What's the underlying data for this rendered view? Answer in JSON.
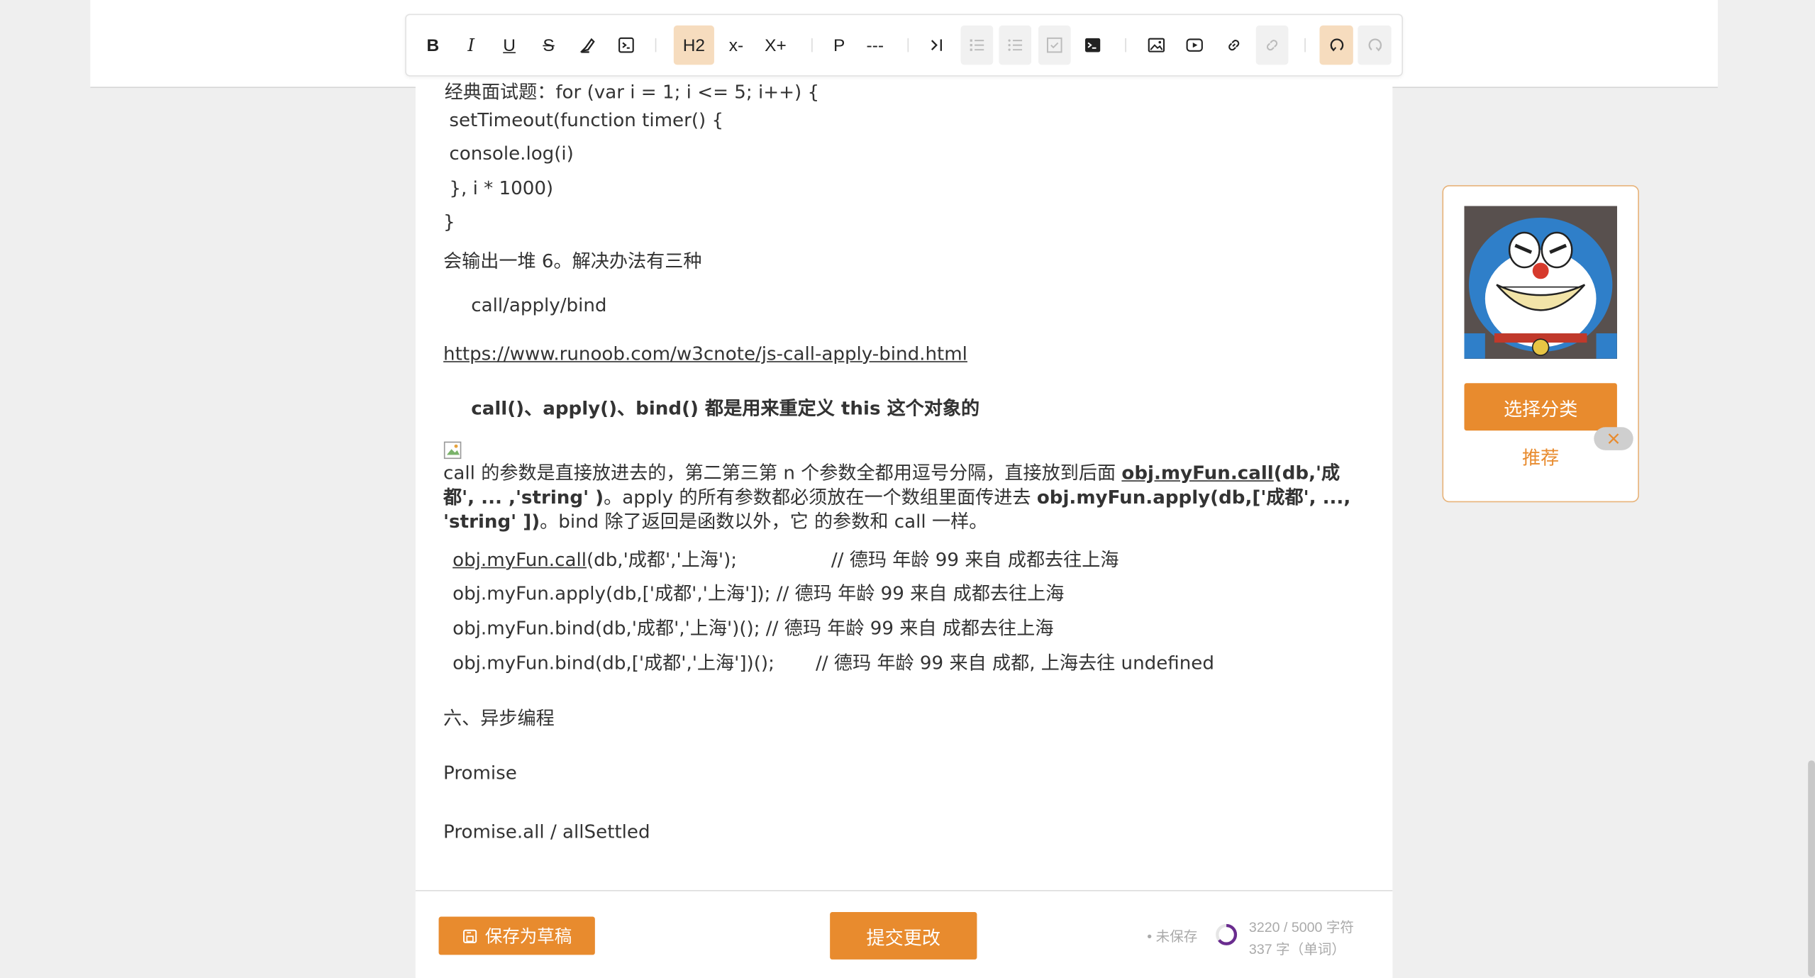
{
  "toolbar": {
    "bold": "B",
    "italic": "I",
    "underline": "U",
    "strike": "S",
    "h2": "H2",
    "subscript": "x-",
    "superscript": "X+",
    "paragraph": "P",
    "hr": "---"
  },
  "content": {
    "line_cut": "经典面试题：for (var i = 1; i <= 5; i++) {",
    "line1": " setTimeout(function timer() {",
    "line2": " console.log(i)",
    "line3": " }, i * 1000)",
    "line4": "}",
    "line5": "会输出一堆 6。解决办法有三种",
    "line6": "call/apply/bind",
    "link": "https://www.runoob.com/w3cnote/js-call-apply-bind.html",
    "heading_bold": "call()、apply()、bind() 都是用来重定义 this 这个对象的",
    "para_a": " call 的参数是直接放进去的，第二第三第 n 个参数全都用逗号分隔，直接放到后面 ",
    "para_b": "obj.myFun.call",
    "para_c": "(db,'成都', ... ,'string' )",
    "para_d": "。apply 的所有参数都必须放在一个数组里面传进去 ",
    "para_e": "obj.myFun.apply(db,['成都', ..., 'string' ])",
    "para_f": "。bind 除了返回是函数以外，它 的参数和 call 一样。",
    "code1_link": "obj.myFun.call",
    "code1_rest": "(db,'成都','上海');                // 德玛 年龄 99 来自 成都去往上海",
    "code2": "obj.myFun.apply(db,['成都','上海']); // 德玛 年龄 99 来自 成都去往上海",
    "code3": "obj.myFun.bind(db,'成都','上海')(); // 德玛 年龄 99 来自 成都去往上海",
    "code4": "obj.myFun.bind(db,['成都','上海'])();       // 德玛 年龄 99 来自 成都, 上海去往 undefined",
    "section6": "六、异步编程",
    "promise": "Promise",
    "promise_all": "Promise.all / allSettled"
  },
  "footer": {
    "draft_label": "保存为草稿",
    "submit_label": "提交更改",
    "unsaved": "• 未保存",
    "char_count": "3220 / 5000 字符",
    "word_count": "337 字（单词）",
    "progress": 0.644
  },
  "side": {
    "choose_category": "选择分类",
    "recommend": "推荐"
  },
  "colors": {
    "accent": "#e88b2e",
    "active_bg": "#f6dcbe",
    "ring": "#6a2c8f"
  }
}
